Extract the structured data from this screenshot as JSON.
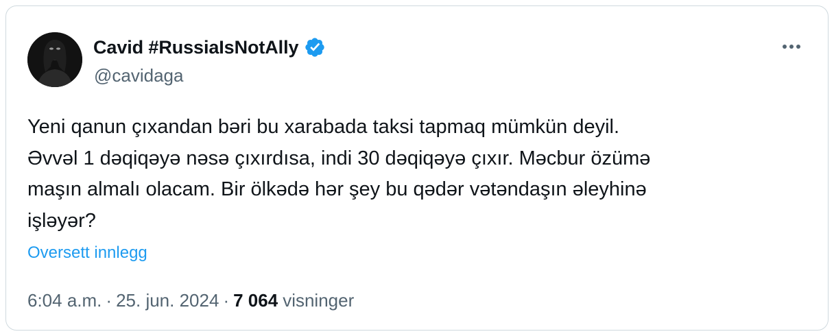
{
  "user": {
    "display_name": "Cavid #RussiaIsNotAlly",
    "handle": "@cavidaga",
    "verified": true
  },
  "tweet": {
    "text": "Yeni qanun çıxandan bəri bu xarabada taksi tapmaq mümkün deyil.\nƏvvəl 1 dəqiqəyə nəsə çıxırdısa, indi 30 dəqiqəyə çıxır. Məcbur özümə\nmaşın almalı olacam. Bir ölkədə hər şey bu qədər vətəndaşın əleyhinə\nişləyər?",
    "translate_label": "Oversett innlegg",
    "time": "6:04 a.m.",
    "separator": "·",
    "date": "25. jun. 2024",
    "views_count": "7 064",
    "views_label": "visninger"
  },
  "icons": {
    "verified": "verified-badge-icon",
    "more": "more-options-icon"
  },
  "colors": {
    "text": "#0f1419",
    "secondary": "#536471",
    "link": "#1d9bf0",
    "border": "#cfd9de"
  }
}
